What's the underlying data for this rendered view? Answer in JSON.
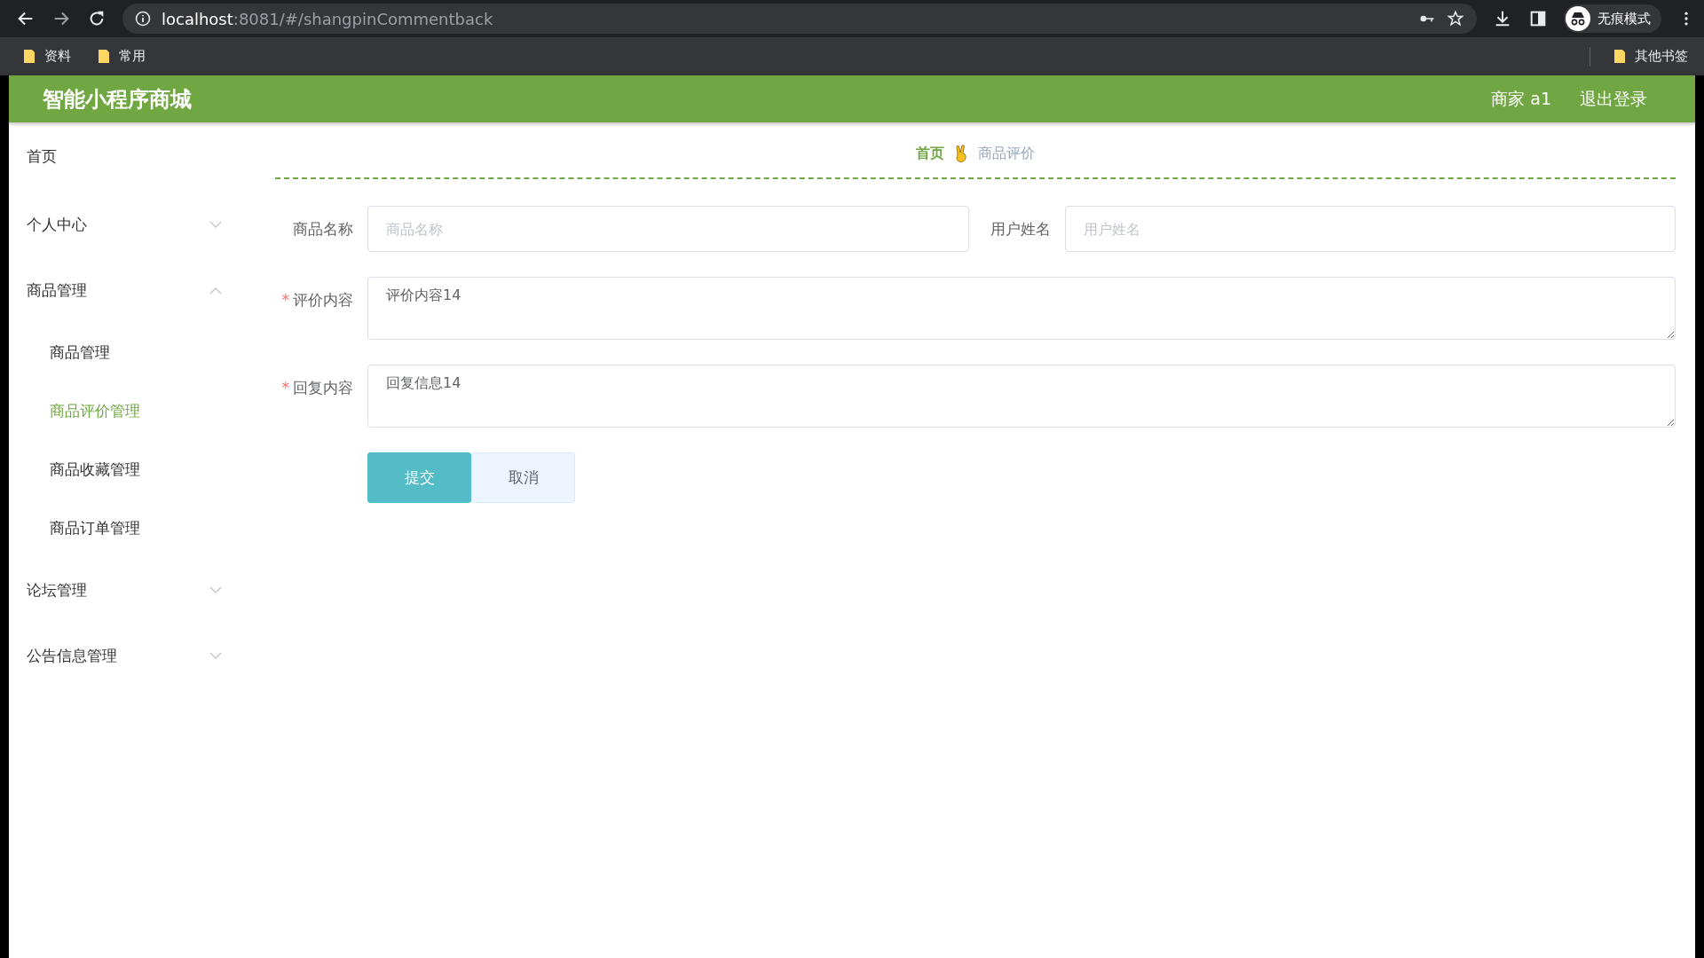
{
  "browser": {
    "url_host": "localhost",
    "url_rest": ":8081/#/shangpinCommentback",
    "incognito_label": "无痕模式",
    "bookmarks": [
      "资料",
      "常用"
    ],
    "other_bookmarks": "其他书签"
  },
  "header": {
    "title": "智能小程序商城",
    "user": "商家 a1",
    "logout": "退出登录"
  },
  "sidebar": {
    "items": [
      {
        "label": "首页",
        "kind": "link"
      },
      {
        "label": "个人中心",
        "kind": "submenu",
        "expanded": false
      },
      {
        "label": "商品管理",
        "kind": "submenu",
        "expanded": true,
        "children": [
          {
            "label": "商品管理",
            "selected": false
          },
          {
            "label": "商品评价管理",
            "selected": true
          },
          {
            "label": "商品收藏管理",
            "selected": false
          },
          {
            "label": "商品订单管理",
            "selected": false
          }
        ]
      },
      {
        "label": "论坛管理",
        "kind": "submenu",
        "expanded": false
      },
      {
        "label": "公告信息管理",
        "kind": "submenu",
        "expanded": false
      }
    ]
  },
  "breadcrumb": [
    "首页",
    "商品评价"
  ],
  "form": {
    "required_mark": "*",
    "rows": [
      [
        {
          "label": "商品名称",
          "kind": "input",
          "required": false,
          "placeholder": "商品名称"
        },
        {
          "label": "用户姓名",
          "kind": "input",
          "required": false,
          "placeholder": "用户姓名"
        }
      ],
      [
        {
          "label": "评价内容",
          "kind": "textarea",
          "required": true,
          "value": "评价内容14"
        }
      ],
      [
        {
          "label": "回复内容",
          "kind": "textarea",
          "required": true,
          "value": "回复信息14"
        }
      ]
    ],
    "buttons": [
      {
        "label": "提交",
        "kind": "primary"
      },
      {
        "label": "取消",
        "kind": "plain"
      }
    ]
  }
}
